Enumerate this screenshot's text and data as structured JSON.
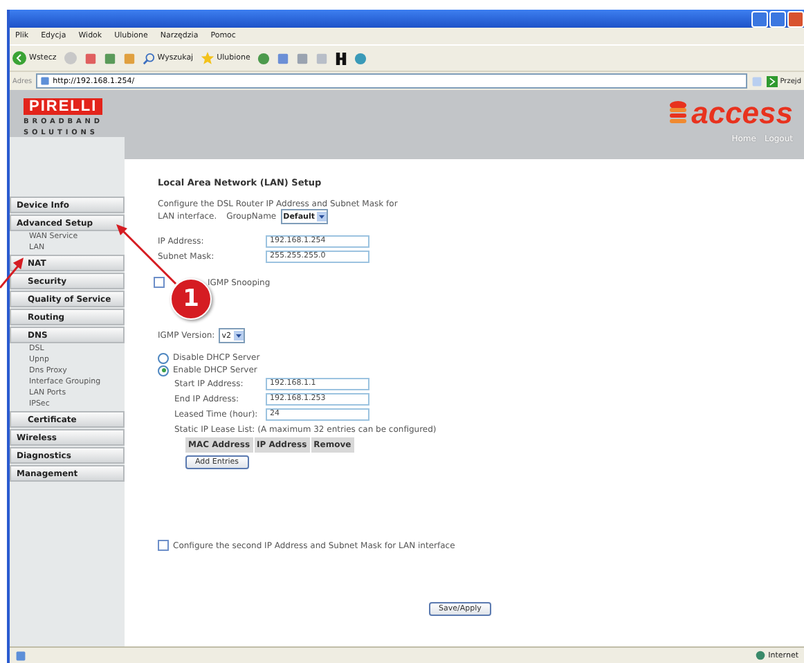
{
  "browser": {
    "menu": [
      "Plik",
      "Edycja",
      "Widok",
      "Ulubione",
      "Narzędzia",
      "Pomoc"
    ],
    "toolbar": {
      "back": "Wstecz",
      "search": "Wyszukaj",
      "favorites": "Ulubione"
    },
    "address": {
      "label": "Adres",
      "value": "http://192.168.1.254/",
      "go": "Przejd"
    }
  },
  "header": {
    "brand": "PIRELLI",
    "tagline": [
      "BROADBAND",
      "SOLUTIONS"
    ],
    "product": "access",
    "links": [
      "Home",
      "Logout"
    ]
  },
  "sidebar": {
    "items": [
      {
        "label": "Device Info",
        "kind": "section"
      },
      {
        "label": "Advanced Setup",
        "kind": "section",
        "children": [
          {
            "label": "WAN Service",
            "kind": "link"
          },
          {
            "label": "LAN",
            "kind": "link"
          },
          {
            "label": "NAT",
            "kind": "section"
          },
          {
            "label": "Security",
            "kind": "section"
          },
          {
            "label": "Quality of Service",
            "kind": "section"
          },
          {
            "label": "Routing",
            "kind": "section"
          },
          {
            "label": "DNS",
            "kind": "section"
          },
          {
            "label": "DSL",
            "kind": "link"
          },
          {
            "label": "Upnp",
            "kind": "link"
          },
          {
            "label": "Dns Proxy",
            "kind": "link"
          },
          {
            "label": "Interface Grouping",
            "kind": "link"
          },
          {
            "label": "LAN Ports",
            "kind": "link"
          },
          {
            "label": "IPSec",
            "kind": "link"
          },
          {
            "label": "Certificate",
            "kind": "section"
          }
        ]
      },
      {
        "label": "Wireless",
        "kind": "section"
      },
      {
        "label": "Diagnostics",
        "kind": "section"
      },
      {
        "label": "Management",
        "kind": "section"
      }
    ]
  },
  "page": {
    "title": "Local Area Network (LAN) Setup",
    "description": "Configure the DSL Router IP Address and Subnet Mask for",
    "description_2": "LAN interface.",
    "group_label": "GroupName",
    "group_value": "Default",
    "ip_fields": [
      {
        "label": "IP Address:",
        "value": "192.168.1.254"
      },
      {
        "label": "Subnet Mask:",
        "value": "255.255.255.0"
      }
    ],
    "snooping": {
      "label": "IGMP Snooping",
      "checked": false
    },
    "igmp_version": {
      "label": "IGMP Version:",
      "value": "v2"
    },
    "dhcp": [
      {
        "label": "Disable DHCP Server",
        "selected": false
      },
      {
        "label": "Enable DHCP Server",
        "selected": true
      }
    ],
    "dhcp_fields": [
      {
        "label": "Start IP Address:",
        "value": "192.168.1.1"
      },
      {
        "label": "End IP Address:",
        "value": "192.168.1.253"
      },
      {
        "label": "Leased Time (hour):",
        "value": "24"
      }
    ],
    "static_list": "Static IP Lease List: (A maximum 32 entries can be configured)",
    "lease_columns": [
      "MAC Address",
      "IP Address",
      "Remove"
    ],
    "add_button": "Add Entries",
    "second_ip": {
      "label": "Configure the second IP Address and Subnet Mask for LAN interface",
      "checked": false
    },
    "save_button": "Save/Apply"
  },
  "status_bar": {
    "zone": "Internet"
  },
  "annotation": {
    "step": "1"
  }
}
